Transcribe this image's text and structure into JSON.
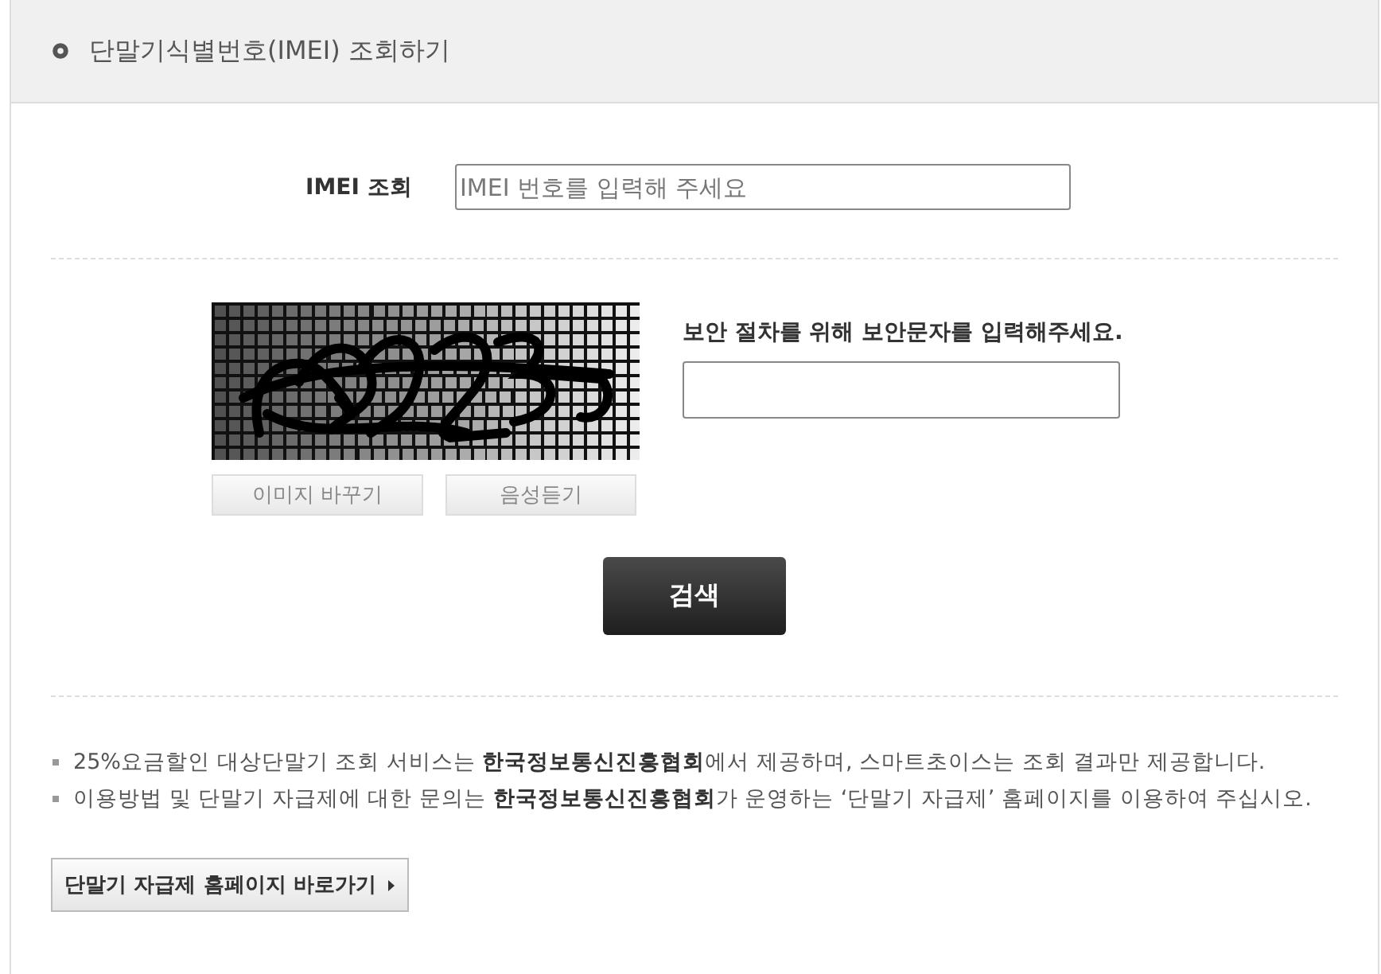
{
  "section": {
    "title": "단말기식별번호(IMEI) 조회하기"
  },
  "imei_lookup": {
    "label": "IMEI 조회",
    "placeholder": "IMEI 번호를 입력해 주세요"
  },
  "captcha": {
    "buttons": [
      "이미지 바꾸기",
      "음성듣기"
    ],
    "prompt": "보안 절차를 위해 보안문자를 입력해주세요."
  },
  "search_button": "검색",
  "notes": [
    "25%요금할인 대상단말기 조회 서비스는 **한국정보통신진흥협회**에서 제공하며, 스마트초이스는 조회 결과만 제공합니다.",
    "이용방법 및 단말기 자급제에 대한 문의는 **한국정보통신진흥협회**가 운영하는 ‘단말기 자급제’ 홈페이지를 이용하여 주십시오."
  ],
  "link_button": "단말기 자급제 홈페이지 바로가기"
}
